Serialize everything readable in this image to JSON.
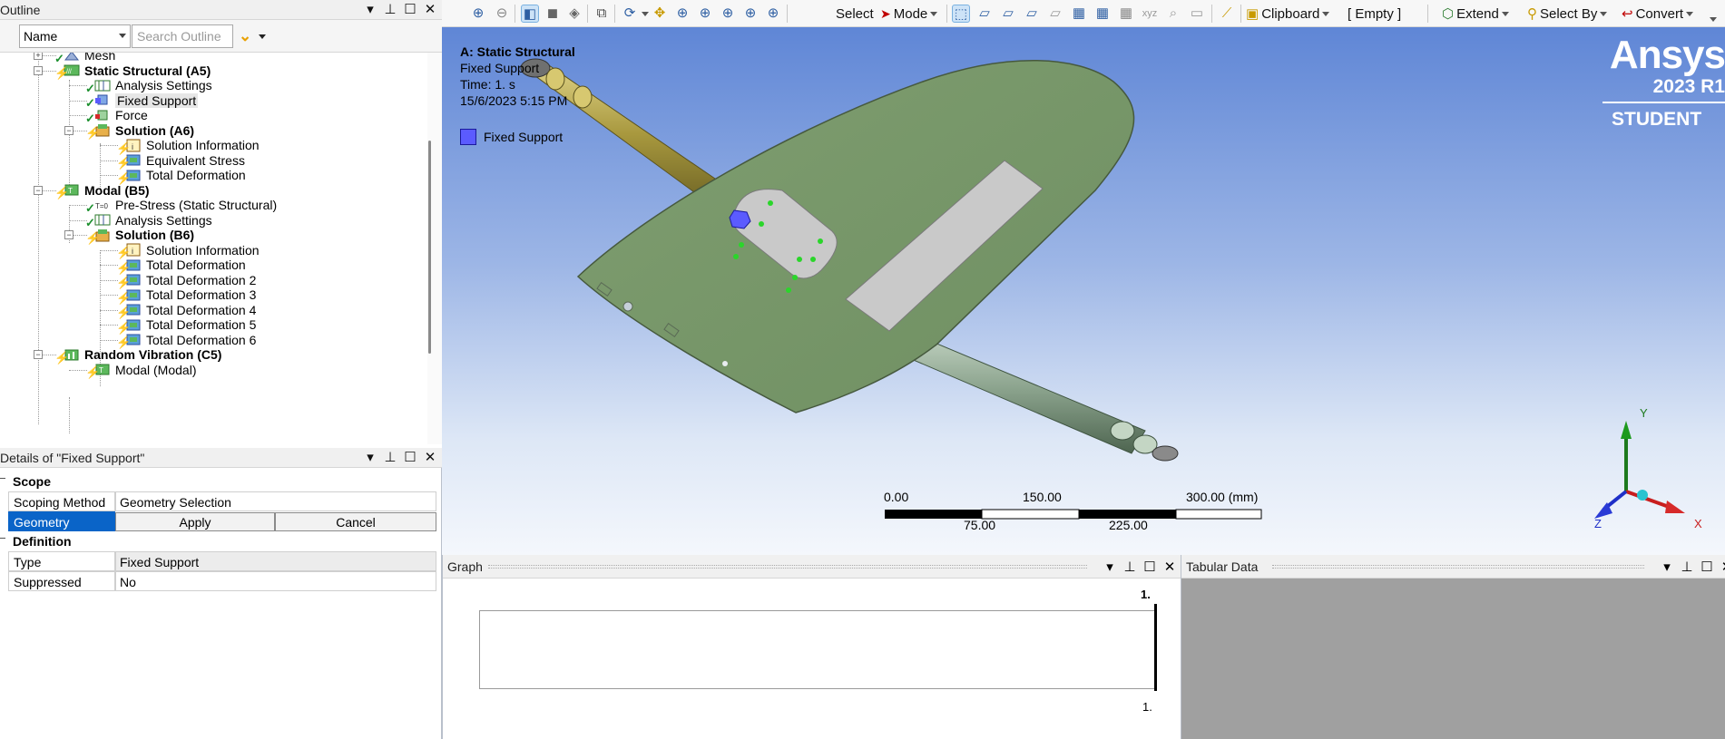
{
  "outline": {
    "title": "Outline",
    "filter_value": "Name",
    "search_placeholder": "Search Outline",
    "tree": [
      {
        "label": "Mesh",
        "bold": false
      },
      {
        "label": "Static Structural (A5)",
        "bold": true
      },
      {
        "label": "Analysis Settings",
        "bold": false
      },
      {
        "label": "Fixed Support",
        "bold": false,
        "selected": true
      },
      {
        "label": "Force",
        "bold": false
      },
      {
        "label": "Solution (A6)",
        "bold": true
      },
      {
        "label": "Solution Information",
        "bold": false
      },
      {
        "label": "Equivalent Stress",
        "bold": false
      },
      {
        "label": "Total Deformation",
        "bold": false
      },
      {
        "label": "Modal (B5)",
        "bold": true
      },
      {
        "label": "Pre-Stress (Static Structural)",
        "bold": false
      },
      {
        "label": "Analysis Settings",
        "bold": false
      },
      {
        "label": "Solution (B6)",
        "bold": true
      },
      {
        "label": "Solution Information",
        "bold": false
      },
      {
        "label": "Total Deformation",
        "bold": false
      },
      {
        "label": "Total Deformation 2",
        "bold": false
      },
      {
        "label": "Total Deformation 3",
        "bold": false
      },
      {
        "label": "Total Deformation 4",
        "bold": false
      },
      {
        "label": "Total Deformation 5",
        "bold": false
      },
      {
        "label": "Total Deformation 6",
        "bold": false
      },
      {
        "label": "Random Vibration (C5)",
        "bold": true
      },
      {
        "label": "Modal (Modal)",
        "bold": false
      }
    ]
  },
  "details": {
    "title": "Details of \"Fixed Support\"",
    "scope_header": "Scope",
    "scoping_method_label": "Scoping Method",
    "scoping_method_value": "Geometry Selection",
    "geometry_label": "Geometry",
    "apply_label": "Apply",
    "cancel_label": "Cancel",
    "definition_header": "Definition",
    "type_label": "Type",
    "type_value": "Fixed Support",
    "suppressed_label": "Suppressed",
    "suppressed_value": "No"
  },
  "toolbar": {
    "select_label": "Select",
    "mode_label": "Mode",
    "clipboard_label": "Clipboard",
    "empty_label": "[ Empty ]",
    "extend_label": "Extend",
    "select_by_label": "Select By",
    "convert_label": "Convert"
  },
  "viewport": {
    "title": "A: Static Structural",
    "subtitle": "Fixed Support",
    "time": "Time: 1. s",
    "date": "15/6/2023 5:15 PM",
    "legend_label": "Fixed Support",
    "legend_color": "#5b5bff",
    "brand": "Ansys",
    "version": "2023 R1",
    "edition": "STUDENT",
    "scale_top": [
      "0.00",
      "150.00",
      "300.00 (mm)"
    ],
    "scale_bottom": [
      "75.00",
      "225.00"
    ],
    "axes": {
      "x": "X",
      "y": "Y",
      "z": "Z"
    }
  },
  "graph": {
    "title": "Graph",
    "top_value": "1.",
    "bottom_value": "1."
  },
  "tabular": {
    "title": "Tabular Data"
  }
}
